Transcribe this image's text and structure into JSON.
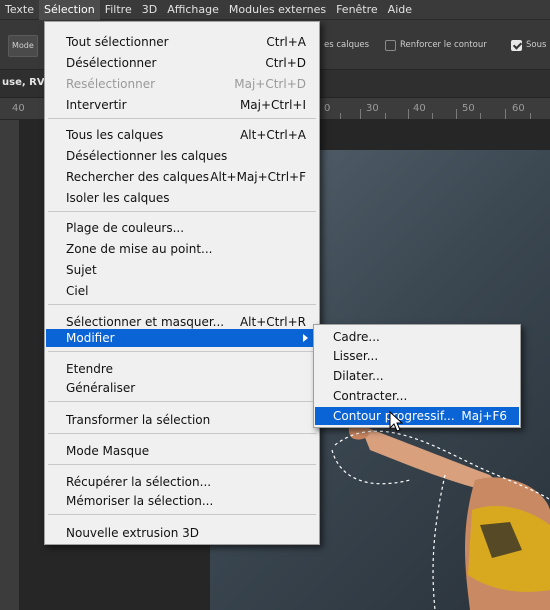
{
  "menubar": {
    "items": [
      "Texte",
      "Sélection",
      "Filtre",
      "3D",
      "Affichage",
      "Modules externes",
      "Fenêtre",
      "Aide"
    ],
    "active_index": 1
  },
  "options_bar": {
    "mode_label": "Mode",
    "all_layers_label": "es calques",
    "strengthen_edge_label": "Renforcer le contour",
    "sous_label": "Sous",
    "strengthen_edge_checked": false,
    "sous_checked": true
  },
  "document_tab": {
    "title": "use, RV"
  },
  "ruler": {
    "labels": [
      "40",
      "0",
      "30",
      "40",
      "50",
      "60"
    ]
  },
  "selection_menu": {
    "items": [
      {
        "label": "Tout sélectionner",
        "shortcut": "Ctrl+A"
      },
      {
        "label": "Désélectionner",
        "shortcut": "Ctrl+D"
      },
      {
        "label": "Resélectionner",
        "shortcut": "Maj+Ctrl+D",
        "disabled": true
      },
      {
        "label": "Intervertir",
        "shortcut": "Maj+Ctrl+I"
      },
      {
        "label": "Tous les calques",
        "shortcut": "Alt+Ctrl+A"
      },
      {
        "label": "Désélectionner les calques",
        "shortcut": ""
      },
      {
        "label": "Rechercher des calques",
        "shortcut": "Alt+Maj+Ctrl+F"
      },
      {
        "label": "Isoler les calques",
        "shortcut": ""
      },
      {
        "label": "Plage de couleurs...",
        "shortcut": ""
      },
      {
        "label": "Zone de mise au point...",
        "shortcut": ""
      },
      {
        "label": "Sujet",
        "shortcut": ""
      },
      {
        "label": "Ciel",
        "shortcut": ""
      },
      {
        "label": "Sélectionner et masquer...",
        "shortcut": "Alt+Ctrl+R"
      },
      {
        "label": "Modifier",
        "shortcut": "",
        "highlighted": true,
        "has_submenu": true
      },
      {
        "label": "Etendre",
        "shortcut": ""
      },
      {
        "label": "Généraliser",
        "shortcut": ""
      },
      {
        "label": "Transformer la sélection",
        "shortcut": ""
      },
      {
        "label": "Mode Masque",
        "shortcut": ""
      },
      {
        "label": "Récupérer la sélection...",
        "shortcut": ""
      },
      {
        "label": "Mémoriser la sélection...",
        "shortcut": ""
      },
      {
        "label": "Nouvelle extrusion 3D",
        "shortcut": ""
      }
    ]
  },
  "modify_submenu": {
    "items": [
      {
        "label": "Cadre...",
        "shortcut": ""
      },
      {
        "label": "Lisser...",
        "shortcut": ""
      },
      {
        "label": "Dilater...",
        "shortcut": ""
      },
      {
        "label": "Contracter...",
        "shortcut": ""
      },
      {
        "label": "Contour progressif...",
        "shortcut": "Maj+F6",
        "highlighted": true
      }
    ]
  },
  "colors": {
    "highlight": "#0a64d6",
    "menu_bg": "#f0f0f0",
    "app_bg": "#2b2b2b"
  }
}
